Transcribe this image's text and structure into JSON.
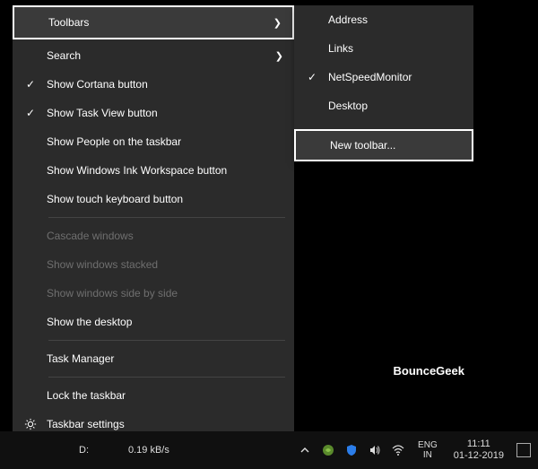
{
  "menu": {
    "items": [
      {
        "label": "Toolbars",
        "check": false,
        "arrow": true,
        "disabled": false,
        "highlight": true
      },
      {
        "label": "Search",
        "check": false,
        "arrow": true,
        "disabled": false
      },
      {
        "label": "Show Cortana button",
        "check": true,
        "arrow": false,
        "disabled": false
      },
      {
        "label": "Show Task View button",
        "check": true,
        "arrow": false,
        "disabled": false
      },
      {
        "label": "Show People on the taskbar",
        "check": false,
        "arrow": false,
        "disabled": false
      },
      {
        "label": "Show Windows Ink Workspace button",
        "check": false,
        "arrow": false,
        "disabled": false
      },
      {
        "label": "Show touch keyboard button",
        "check": false,
        "arrow": false,
        "disabled": false
      },
      {
        "separator": true
      },
      {
        "label": "Cascade windows",
        "check": false,
        "arrow": false,
        "disabled": true
      },
      {
        "label": "Show windows stacked",
        "check": false,
        "arrow": false,
        "disabled": true
      },
      {
        "label": "Show windows side by side",
        "check": false,
        "arrow": false,
        "disabled": true
      },
      {
        "label": "Show the desktop",
        "check": false,
        "arrow": false,
        "disabled": false
      },
      {
        "separator": true
      },
      {
        "label": "Task Manager",
        "check": false,
        "arrow": false,
        "disabled": false
      },
      {
        "separator": true
      },
      {
        "label": "Lock the taskbar",
        "check": false,
        "arrow": false,
        "disabled": false
      },
      {
        "label": "Taskbar settings",
        "check": false,
        "arrow": false,
        "disabled": false,
        "icon": "gear"
      }
    ],
    "submenu": [
      {
        "label": "Address",
        "check": false
      },
      {
        "label": "Links",
        "check": false
      },
      {
        "label": "NetSpeedMonitor",
        "check": true
      },
      {
        "label": "Desktop",
        "check": false
      },
      {
        "label": "New toolbar...",
        "check": false,
        "highlight": true
      }
    ]
  },
  "watermark": "BounceGeek",
  "taskbar": {
    "drive": "D:",
    "netspeed": "0.19 kB/s",
    "lang_top": "ENG",
    "lang_bottom": "IN",
    "time": "11:11",
    "date": "01-12-2019"
  }
}
